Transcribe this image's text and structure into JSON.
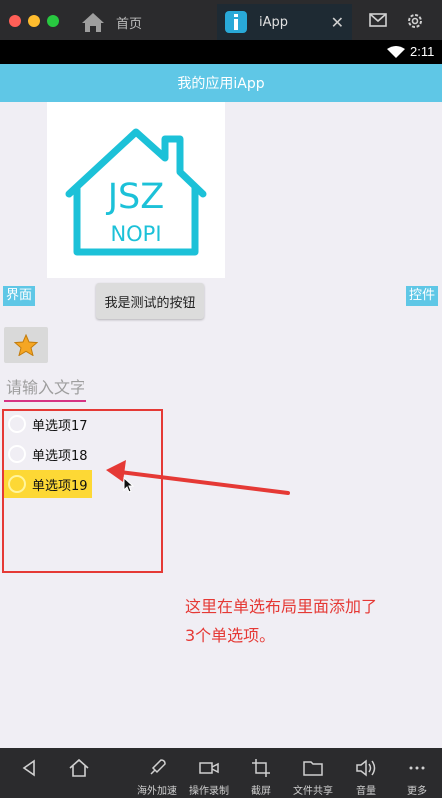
{
  "emulator": {
    "tabs": [
      {
        "label": "首页"
      },
      {
        "label": "iApp"
      }
    ],
    "close_glyph": "✕"
  },
  "status_bar": {
    "time": "2:11"
  },
  "app": {
    "title": "我的应用iApp",
    "logo": {
      "line1": "JSZ",
      "line2": "NOPI"
    },
    "label_left": "界面",
    "label_right": "控件",
    "test_button": "我是测试的按钮",
    "input_placeholder": "请输入文字",
    "radio_options": [
      {
        "label": "单选项17",
        "checked": false
      },
      {
        "label": "单选项18",
        "checked": false
      },
      {
        "label": "单选项19",
        "checked": false,
        "highlighted": true
      }
    ]
  },
  "annotation": {
    "line1": "这里在单选布局里面添加了",
    "line2": "3个单选项。",
    "color": "#e53935"
  },
  "toolbar": {
    "items": [
      {
        "label": "",
        "icon": "back-icon"
      },
      {
        "label": "",
        "icon": "home-icon"
      },
      {
        "label": "海外加速",
        "icon": "rocket-icon"
      },
      {
        "label": "操作录制",
        "icon": "video-icon"
      },
      {
        "label": "截屏",
        "icon": "crop-icon"
      },
      {
        "label": "文件共享",
        "icon": "folder-icon"
      },
      {
        "label": "音量",
        "icon": "volume-icon"
      },
      {
        "label": "更多",
        "icon": "more-icon"
      }
    ]
  },
  "colors": {
    "app_bar": "#5fc7e6",
    "logo_teal": "#1cc1d8",
    "highlight": "#fdd835",
    "input_underline": "#d63384"
  }
}
